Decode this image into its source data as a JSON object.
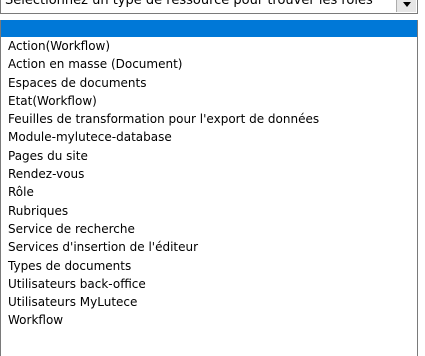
{
  "select": {
    "current_value": "Sélectionnez un type de ressource pour trouver les rôles",
    "icon": "chevron-down-icon"
  },
  "dropdown": {
    "highlight_color": "#0078d7",
    "options": [
      {
        "label": ""
      },
      {
        "label": "Action(Workflow)"
      },
      {
        "label": "Action en masse (Document)"
      },
      {
        "label": "Espaces de documents"
      },
      {
        "label": "Etat(Workflow)"
      },
      {
        "label": "Feuilles de transformation pour l'export de données"
      },
      {
        "label": "Module-mylutece-database"
      },
      {
        "label": "Pages du site"
      },
      {
        "label": "Rendez-vous"
      },
      {
        "label": "Rôle"
      },
      {
        "label": "Rubriques"
      },
      {
        "label": "Service de recherche"
      },
      {
        "label": "Services d'insertion de l'éditeur"
      },
      {
        "label": "Types de documents"
      },
      {
        "label": "Utilisateurs back-office"
      },
      {
        "label": "Utilisateurs MyLutece"
      },
      {
        "label": "Workflow"
      }
    ]
  }
}
